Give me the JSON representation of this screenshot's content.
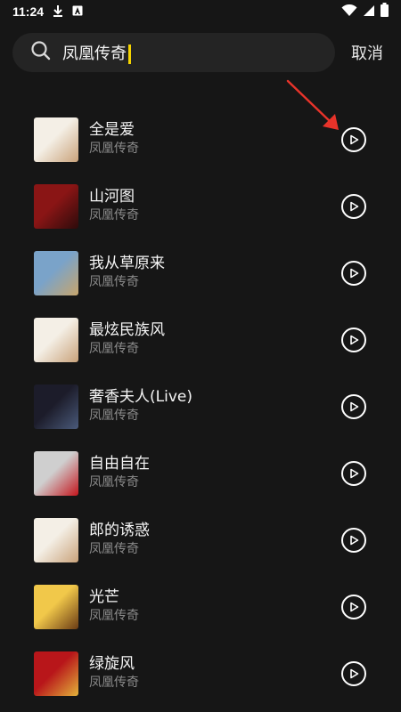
{
  "status": {
    "time": "11:24"
  },
  "search": {
    "query": "凤凰传奇",
    "cancel_label": "取消"
  },
  "songs": [
    {
      "title": "全是爱",
      "artist": "凤凰传奇",
      "cover": [
        "#f4efe6",
        "#c9a27a"
      ]
    },
    {
      "title": "山河图",
      "artist": "凤凰传奇",
      "cover": [
        "#8a1515",
        "#2c0b0b"
      ]
    },
    {
      "title": "我从草原来",
      "artist": "凤凰传奇",
      "cover": [
        "#7aa3c9",
        "#c7a56c"
      ]
    },
    {
      "title": "最炫民族风",
      "artist": "凤凰传奇",
      "cover": [
        "#f4efe6",
        "#c9a27a"
      ]
    },
    {
      "title": "奢香夫人(Live)",
      "artist": "凤凰传奇",
      "cover": [
        "#1c1c2a",
        "#4a5a7a"
      ]
    },
    {
      "title": "自由自在",
      "artist": "凤凰传奇",
      "cover": [
        "#cfcfcf",
        "#c4151c"
      ]
    },
    {
      "title": "郎的诱惑",
      "artist": "凤凰传奇",
      "cover": [
        "#f4efe6",
        "#c9a27a"
      ]
    },
    {
      "title": "光芒",
      "artist": "凤凰传奇",
      "cover": [
        "#f1c84a",
        "#6a3b14"
      ]
    },
    {
      "title": "绿旋风",
      "artist": "凤凰传奇",
      "cover": [
        "#b8161a",
        "#e2b23a"
      ]
    }
  ]
}
